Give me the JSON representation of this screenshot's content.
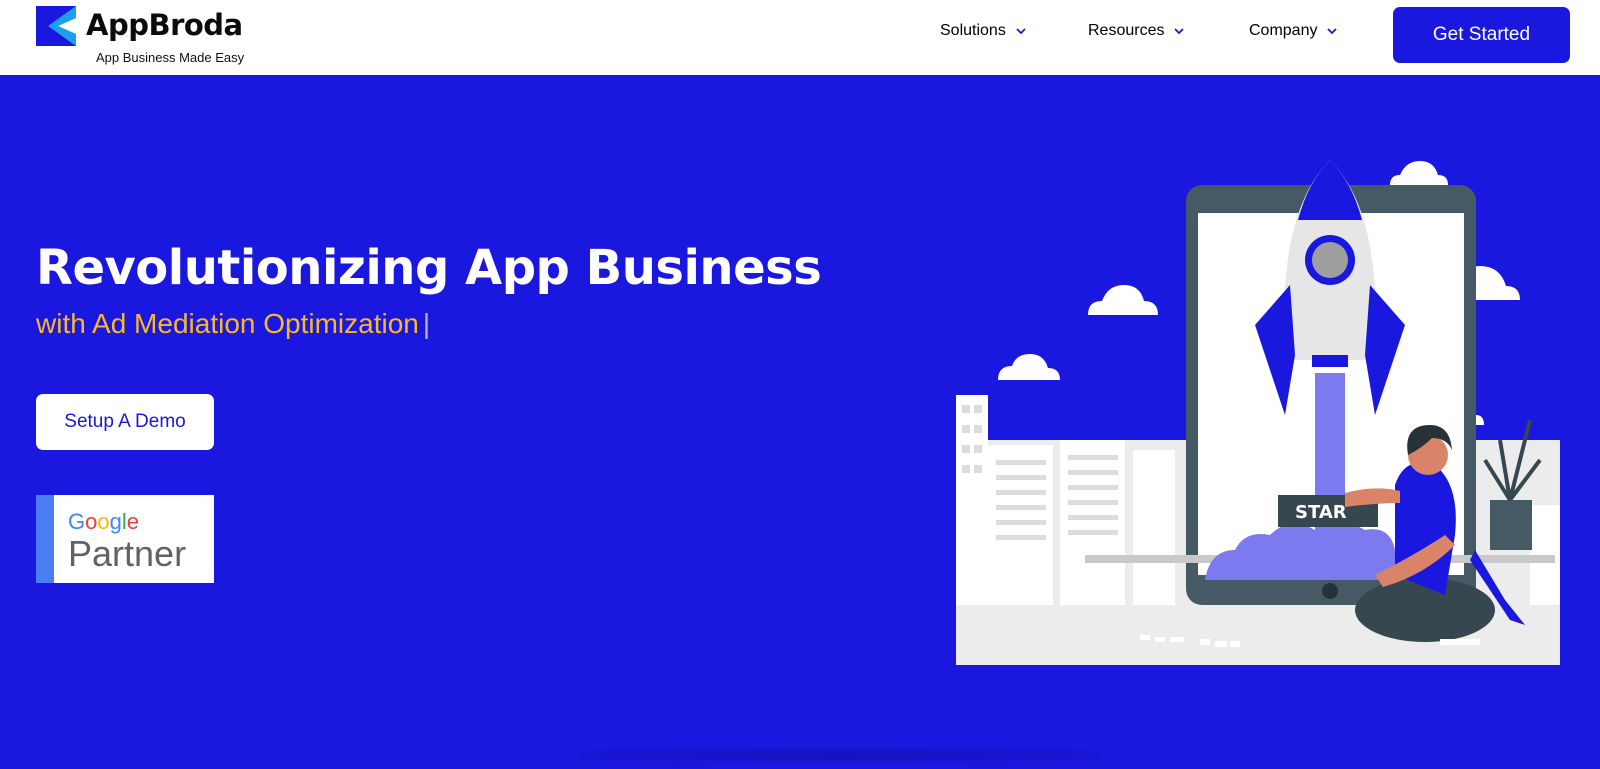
{
  "brand": {
    "name": "AppBroda",
    "tagline": "App Business Made Easy",
    "primary_color": "#1a17df",
    "accent_color": "#f7b92a"
  },
  "nav": {
    "items": [
      {
        "label": "Solutions",
        "icon": "chevron-down-icon"
      },
      {
        "label": "Resources",
        "icon": "chevron-down-icon"
      },
      {
        "label": "Company",
        "icon": "chevron-down-icon"
      }
    ],
    "cta_label": "Get Started"
  },
  "hero": {
    "title": "Revolutionizing App Business",
    "subtitle": "with Ad Mediation Optimization",
    "cursor": "|",
    "demo_label": "Setup A Demo"
  },
  "badge": {
    "google_text": "Google",
    "partner_text": "Partner"
  },
  "illustration": {
    "button_text": "STAR"
  }
}
